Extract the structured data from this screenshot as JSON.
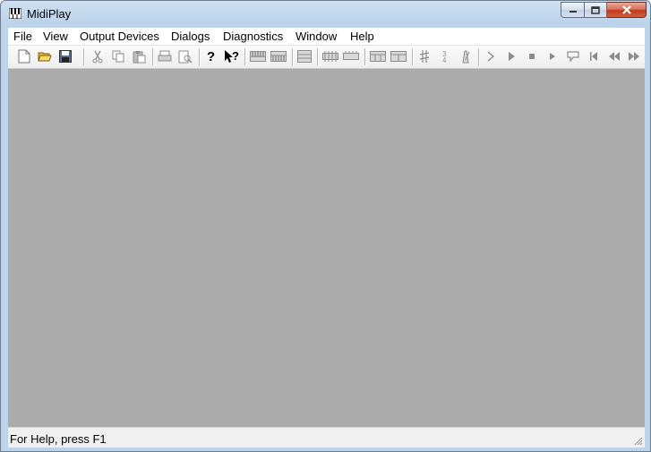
{
  "window": {
    "title": "MidiPlay"
  },
  "menu": [
    "File",
    "View",
    "Output Devices",
    "Dialogs",
    "Diagnostics",
    "Window",
    "Help"
  ],
  "toolbar": [
    {
      "name": "new-file-icon"
    },
    {
      "name": "open-folder-icon"
    },
    {
      "name": "save-icon"
    },
    {
      "name": "cut-icon"
    },
    {
      "name": "copy-icon"
    },
    {
      "name": "paste-icon"
    },
    {
      "name": "print-icon"
    },
    {
      "name": "print-preview-icon"
    },
    {
      "name": "help-icon"
    },
    {
      "name": "context-help-icon"
    },
    {
      "name": "keyboard-icon"
    },
    {
      "name": "keyboard-alt-icon"
    },
    {
      "name": "piano-roll-icon"
    },
    {
      "name": "staff-icon"
    },
    {
      "name": "staff-alt-icon"
    },
    {
      "name": "track-icon"
    },
    {
      "name": "track-alt-icon"
    },
    {
      "name": "sharp-icon"
    },
    {
      "name": "time-signature-icon"
    },
    {
      "name": "metronome-icon"
    },
    {
      "name": "step-icon"
    },
    {
      "name": "play-icon"
    },
    {
      "name": "stop-icon"
    },
    {
      "name": "pause-icon"
    },
    {
      "name": "loop-icon"
    },
    {
      "name": "rewind-to-start-icon"
    },
    {
      "name": "rewind-icon"
    },
    {
      "name": "fast-forward-icon"
    }
  ],
  "status": {
    "text": "For Help, press F1"
  },
  "colors": {
    "mdi_background": "#ababab",
    "toolbar_icon_disabled": "#8c8c8c"
  }
}
